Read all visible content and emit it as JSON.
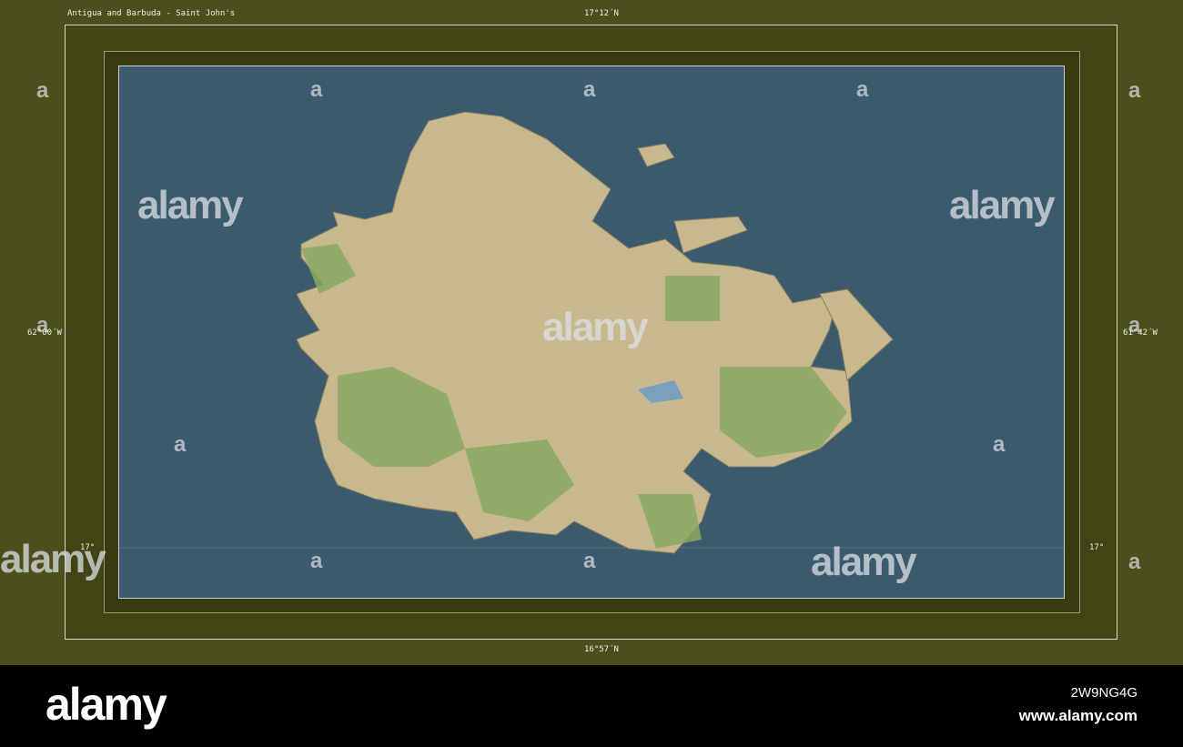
{
  "map": {
    "title": "Antigua and Barbuda - Saint John's",
    "lat_top": "17°12´N",
    "lat_bottom": "16°57´N",
    "lon_left": "62°00´W",
    "lon_right": "61°42´W",
    "lat_line_left": "17°",
    "lat_line_right": "17°"
  },
  "watermark": {
    "brand": "alamy",
    "glyph": "a",
    "url": "www.alamy.com",
    "id": "2W9NG4G"
  },
  "colors": {
    "frame": "#4c4e1e",
    "water": "#3c5a6e",
    "land": "#c8b88e",
    "forest": "#8aa862"
  }
}
